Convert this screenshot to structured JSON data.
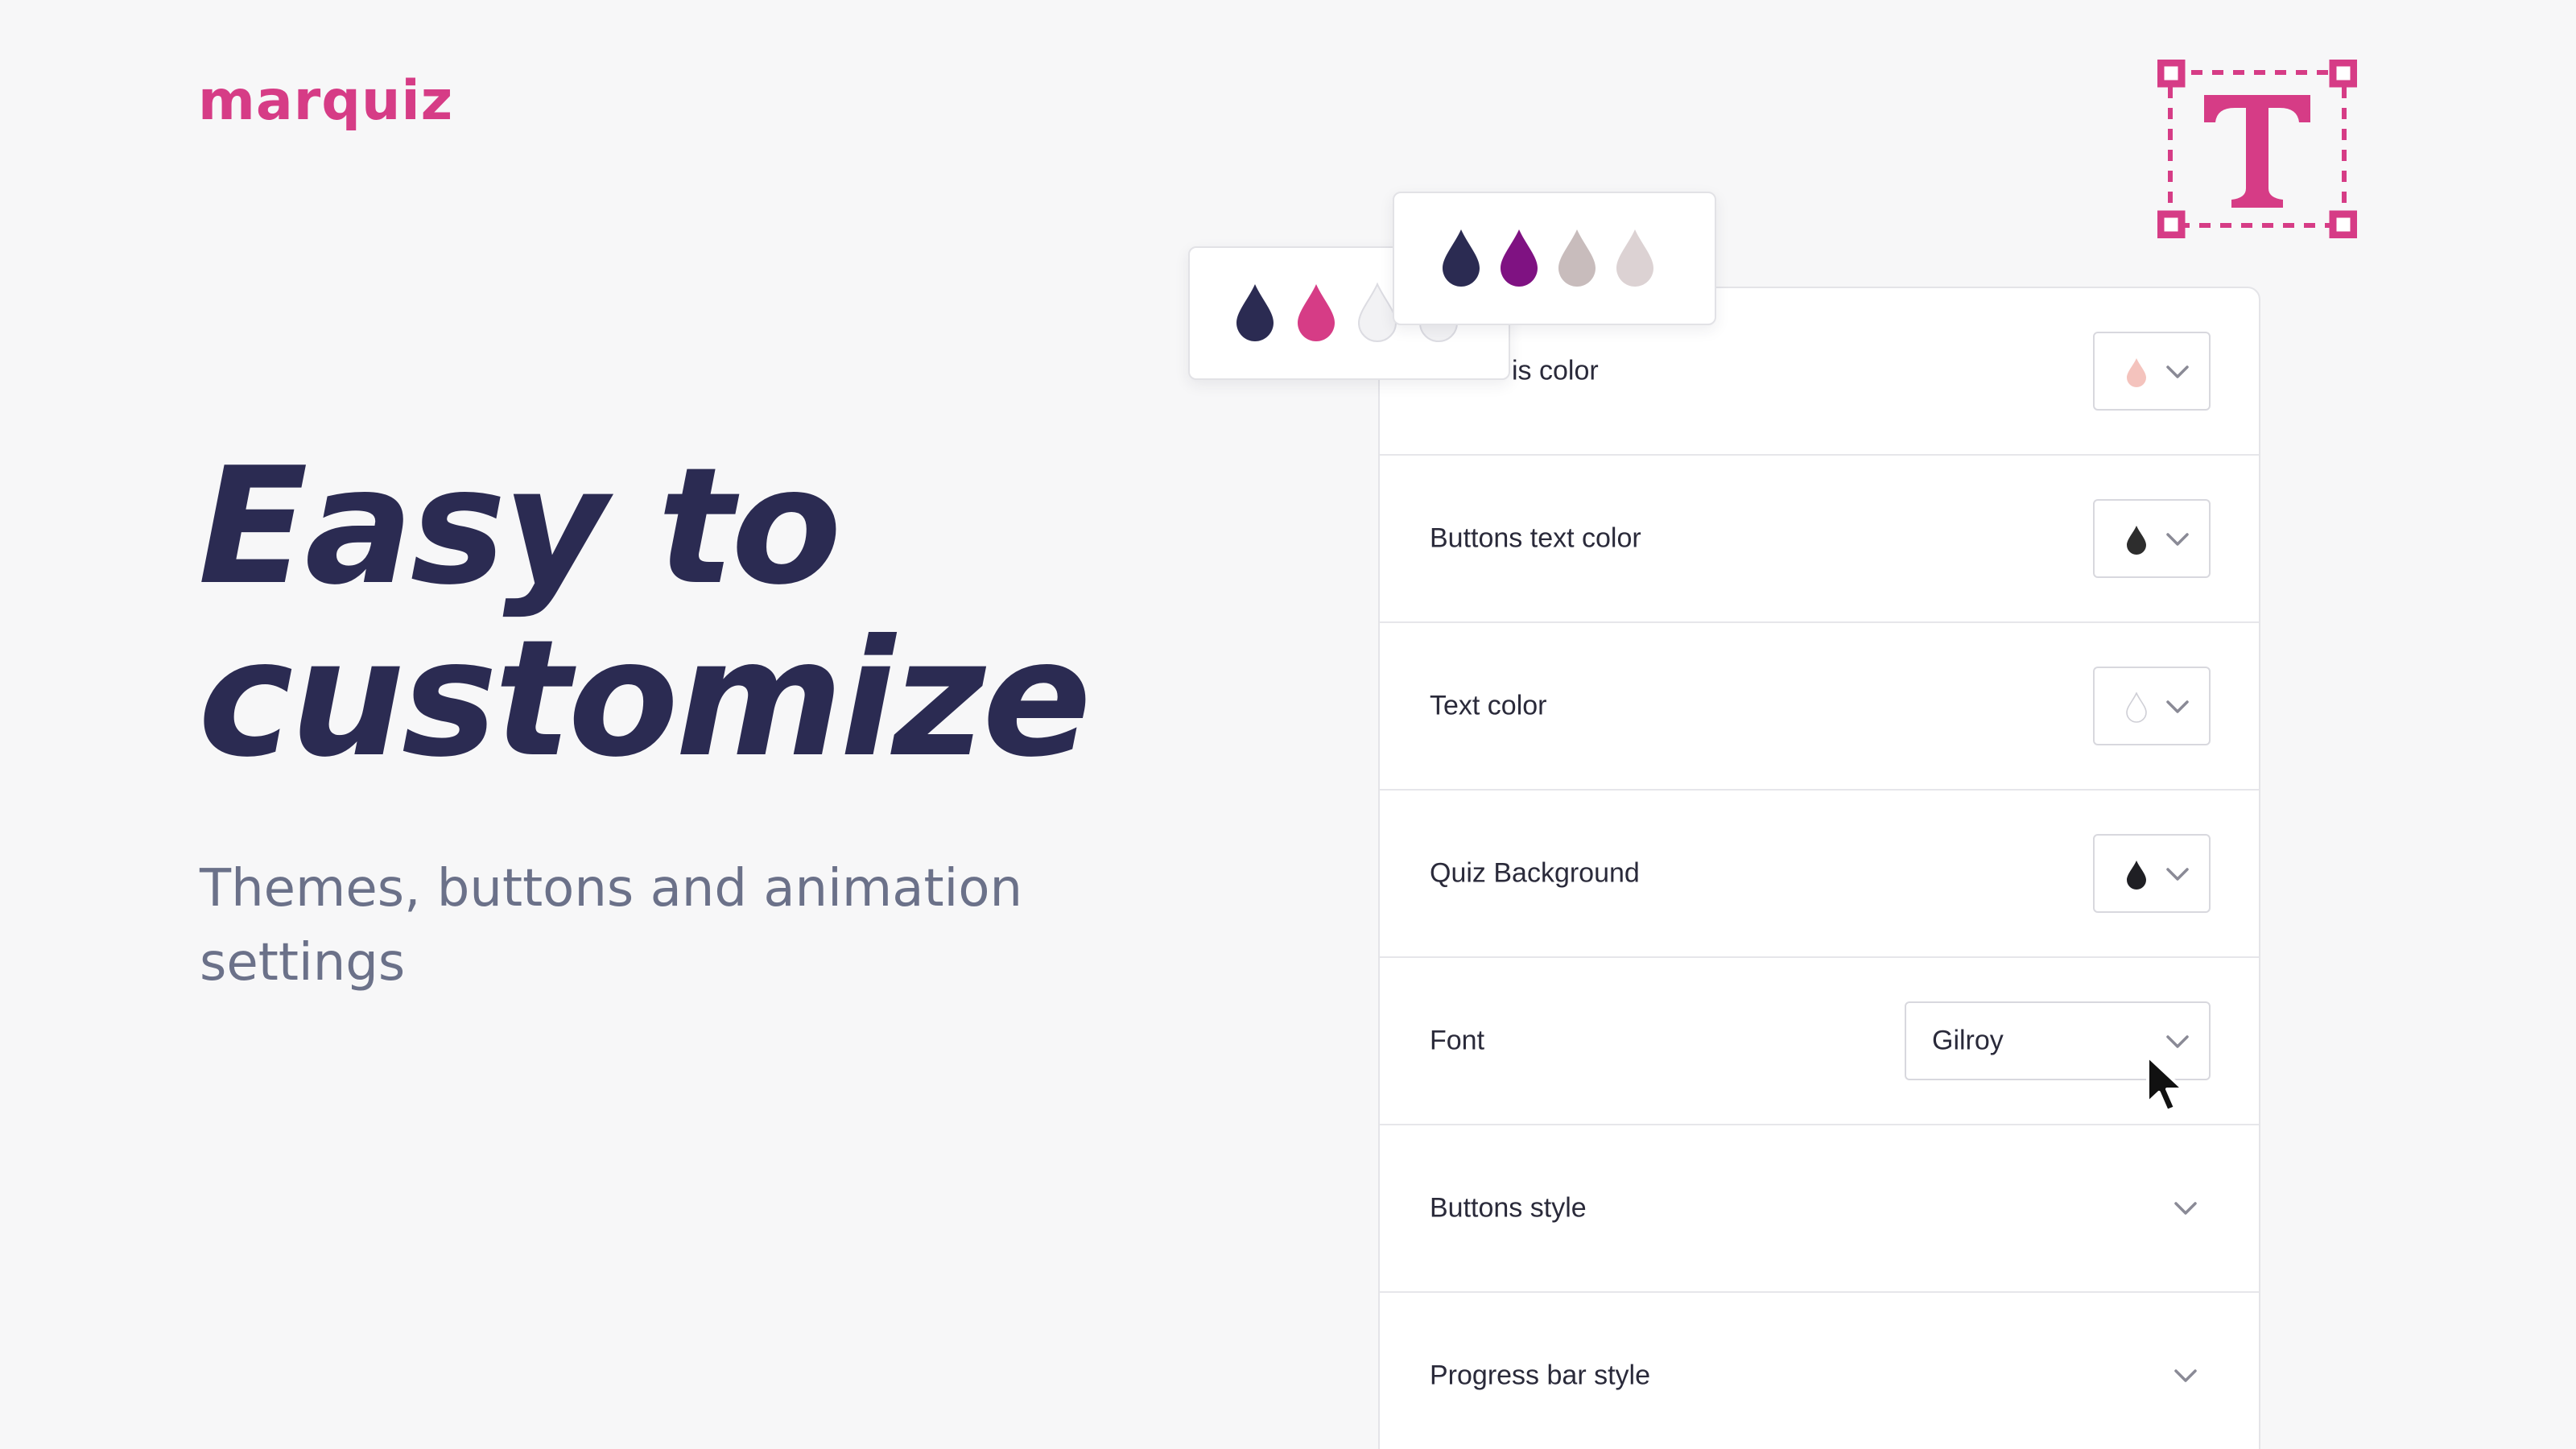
{
  "brand": {
    "logo_text": "marquiz",
    "color": "#d63c86"
  },
  "hero": {
    "title_line1": "Easy to",
    "title_line2": "customize",
    "subtitle": "Themes, buttons and animation settings"
  },
  "settings": {
    "rows": [
      {
        "label": "is color",
        "control": "color",
        "swatch": "#f4c3bd"
      },
      {
        "label": "Buttons text color",
        "control": "color",
        "swatch": "#2d2d2d"
      },
      {
        "label": "Text color",
        "control": "color",
        "swatch": "#ffffff"
      },
      {
        "label": "Quiz Background",
        "control": "color",
        "swatch": "#1f1f24"
      },
      {
        "label": "Font",
        "control": "select",
        "value": "Gilroy"
      },
      {
        "label": "Buttons style",
        "control": "expand"
      },
      {
        "label": "Progress bar style",
        "control": "expand"
      }
    ]
  },
  "palettes": [
    {
      "colors": [
        "#2b2b52",
        "#d63c86",
        "#f2f2f4",
        "#f2f2f4"
      ]
    },
    {
      "colors": [
        "#2b2b52",
        "#7f1282",
        "#c8bcbc",
        "#dcd2d3"
      ]
    }
  ],
  "icons": {
    "text_tool": "text-frame-icon",
    "chevron": "chevron-down-icon",
    "drop": "color-drop-icon",
    "cursor": "mouse-pointer-icon"
  },
  "colors": {
    "accent": "#d63c86",
    "heading": "#2b2b52",
    "subtitle": "#6b7189",
    "chevron": "#8a8a96"
  }
}
